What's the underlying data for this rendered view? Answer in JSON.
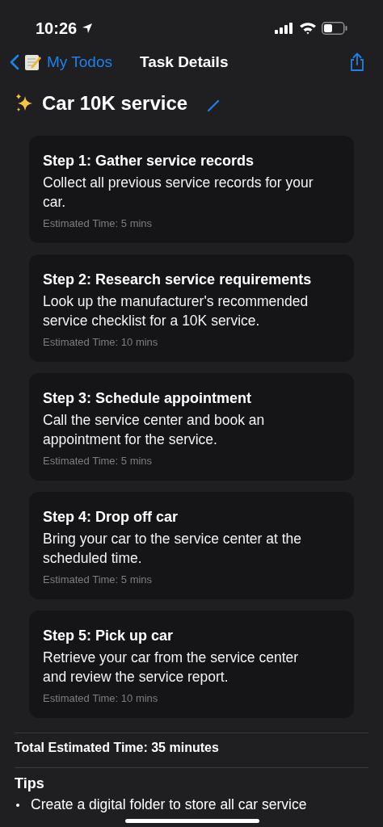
{
  "status_bar": {
    "time": "10:26"
  },
  "nav": {
    "back_label": "My Todos",
    "title": "Task Details"
  },
  "task": {
    "title": "Car 10K service"
  },
  "steps": [
    {
      "title": "Step 1: Gather service records",
      "description": "Collect all previous service records for your car.",
      "estimate": "Estimated Time: 5 mins"
    },
    {
      "title": "Step 2: Research service requirements",
      "description": "Look up the manufacturer's recommended service checklist for a 10K service.",
      "estimate": "Estimated Time: 10 mins"
    },
    {
      "title": "Step 3: Schedule appointment",
      "description": "Call the service center and book an appointment for the service.",
      "estimate": "Estimated Time: 5 mins"
    },
    {
      "title": "Step 4: Drop off car",
      "description": "Bring your car to the service center at the scheduled time.",
      "estimate": "Estimated Time: 5 mins"
    },
    {
      "title": "Step 5: Pick up car",
      "description": "Retrieve your car from the service center and review the service report.",
      "estimate": "Estimated Time: 10 mins"
    }
  ],
  "total": "Total Estimated Time: 35 minutes",
  "tips": {
    "heading": "Tips",
    "items": [
      "Create a digital folder to store all car service"
    ]
  }
}
